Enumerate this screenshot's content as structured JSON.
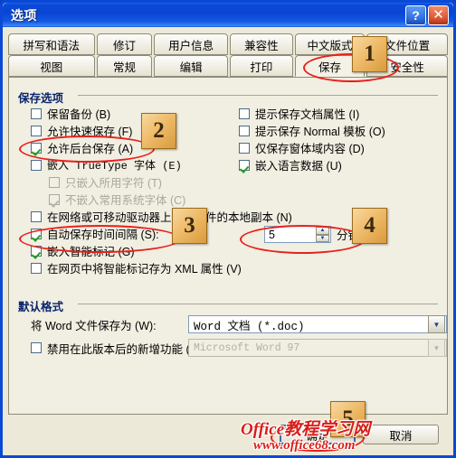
{
  "window": {
    "title": "选项",
    "help_button": "?",
    "close_button": "✕"
  },
  "tabs": {
    "row1": [
      {
        "label": "拼写和语法",
        "active": false
      },
      {
        "label": "修订",
        "active": false
      },
      {
        "label": "用户信息",
        "active": false
      },
      {
        "label": "兼容性",
        "active": false
      },
      {
        "label": "中文版式",
        "active": false
      },
      {
        "label": "文件位置",
        "active": false
      }
    ],
    "row2": [
      {
        "label": "视图",
        "active": false
      },
      {
        "label": "常规",
        "active": false
      },
      {
        "label": "编辑",
        "active": false
      },
      {
        "label": "打印",
        "active": false
      },
      {
        "label": "保存",
        "active": true
      },
      {
        "label": "安全性",
        "active": false
      }
    ]
  },
  "save_options": {
    "title": "保存选项",
    "left_column": [
      {
        "label": "保留备份 (B)",
        "checked": false,
        "disabled": false
      },
      {
        "label": "允许快速保存 (F)",
        "checked": false,
        "disabled": false
      },
      {
        "label": "允许后台保存 (A)",
        "checked": true,
        "disabled": false
      },
      {
        "label": "嵌入 TrueType 字体 (E)",
        "checked": false,
        "disabled": false
      },
      {
        "label": "只嵌入所用字符 (T)",
        "checked": false,
        "disabled": true
      },
      {
        "label": "不嵌入常用系统字体 (C)",
        "checked": true,
        "disabled": true
      },
      {
        "label": "在网络或可移动驱动器上存储文件的本地副本 (N)",
        "checked": false,
        "disabled": false
      },
      {
        "label": "自动保存时间间隔 (S):",
        "checked": true,
        "disabled": false
      },
      {
        "label": "嵌入智能标记 (G)",
        "checked": true,
        "disabled": false
      },
      {
        "label": "在网页中将智能标记存为 XML 属性 (V)",
        "checked": false,
        "disabled": false
      }
    ],
    "right_column": [
      {
        "label": "提示保存文档属性 (I)",
        "checked": false,
        "disabled": false
      },
      {
        "label": "提示保存 Normal 模板 (O)",
        "checked": false,
        "disabled": false
      },
      {
        "label": "仅保存窗体域内容 (D)",
        "checked": false,
        "disabled": false
      },
      {
        "label": "嵌入语言数据 (U)",
        "checked": true,
        "disabled": false
      }
    ],
    "interval_spinner": {
      "value": "5",
      "up_glyph": "▲",
      "down_glyph": "▼",
      "unit_label": "分钟 (M)"
    }
  },
  "default_format": {
    "title": "默认格式",
    "save_as_label": "将 Word 文件保存为 (W):",
    "save_as_value": "Word 文档  (*.doc)",
    "disable_features": {
      "label": "禁用在此版本后的新增功能 (L):",
      "checked": false,
      "value": "Microsoft Word 97"
    },
    "arrow_glyph": "▼"
  },
  "buttons": {
    "ok": "确定",
    "cancel": "取消"
  },
  "annotations": {
    "badges": [
      {
        "number": "1"
      },
      {
        "number": "2"
      },
      {
        "number": "3"
      },
      {
        "number": "4"
      },
      {
        "number": "5"
      }
    ]
  },
  "watermark": {
    "line1": "Office教程学习网",
    "line2": "www.office68.com"
  },
  "colors": {
    "title_bar": "#0a44d2",
    "group_title": "#0a246a",
    "dialog_face": "#ece9d8",
    "panel_face": "#f1eee2",
    "annotation_red": "#e8201a",
    "badge_gold": "#efbc6b",
    "check_green": "#22a022"
  }
}
